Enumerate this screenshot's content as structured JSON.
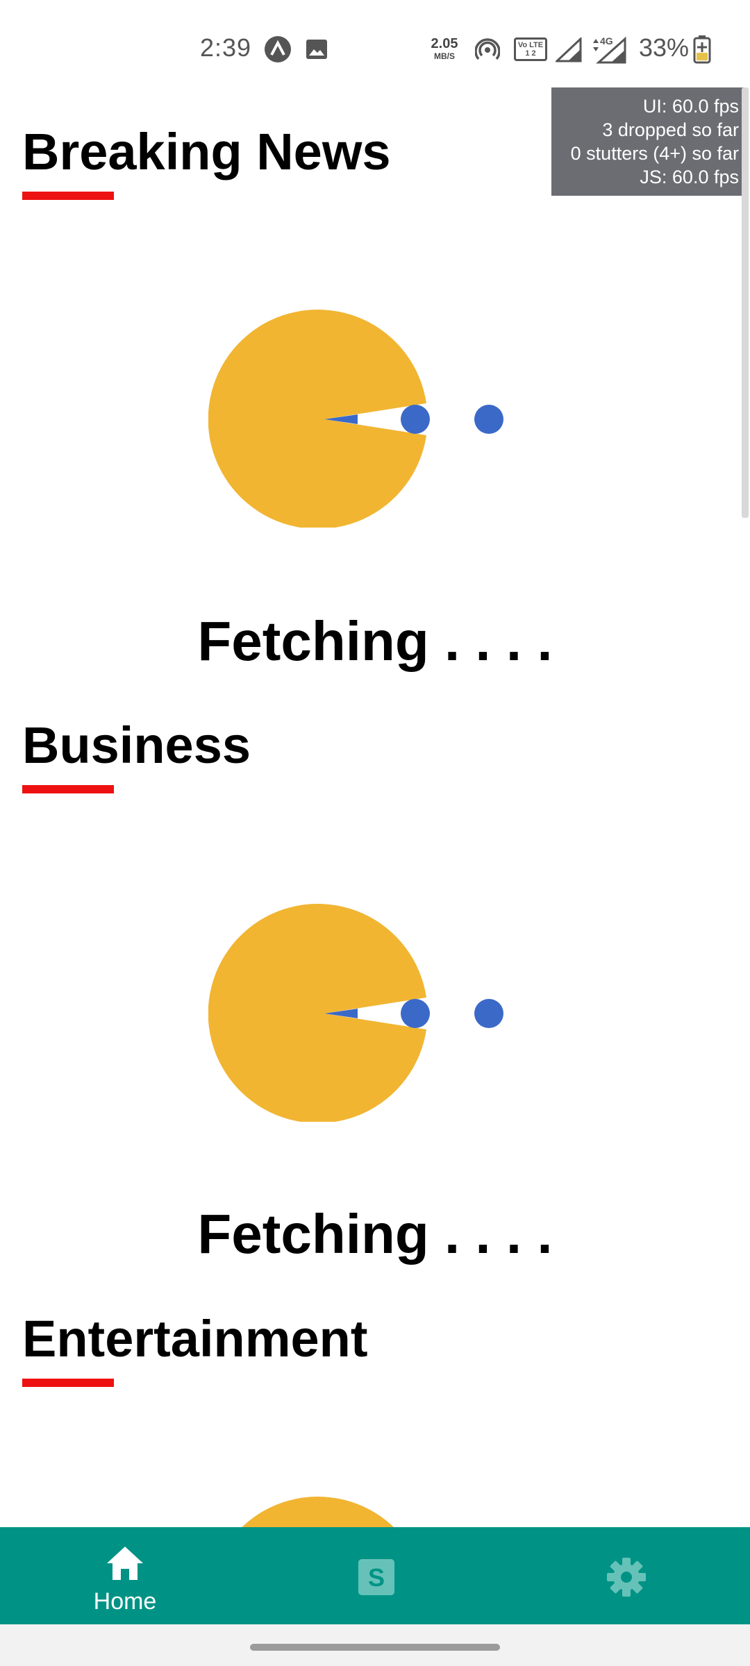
{
  "status_bar": {
    "time": "2:39",
    "icons": [
      "app-a-icon",
      "image-icon",
      "hotspot-icon",
      "signal-icon",
      "signal-4g-icon",
      "battery-icon"
    ],
    "net_speed_value": "2.05",
    "net_speed_unit": "MB/S",
    "volte_label": "Vo LTE 1 2",
    "network_type": "4G",
    "battery_percent": "33%"
  },
  "perf_monitor": {
    "ui_fps": "UI: 60.0 fps",
    "dropped": "3 dropped so far",
    "stutters": "0 stutters (4+) so far",
    "js_fps": "JS: 60.0 fps"
  },
  "sections": [
    {
      "title": "Breaking News",
      "loading_text": "Fetching . . . ."
    },
    {
      "title": "Business",
      "loading_text": "Fetching . . . ."
    },
    {
      "title": "Entertainment",
      "loading_text": ""
    }
  ],
  "colors": {
    "accent_underline": "#ee1111",
    "loader_body": "#f1b532",
    "loader_dots": "#3b69c8",
    "bottom_nav": "#009385"
  },
  "bottom_nav": {
    "items": [
      {
        "label": "Home",
        "icon": "home-icon"
      },
      {
        "label": "",
        "icon": "s-square-icon"
      },
      {
        "label": "",
        "icon": "gear-icon"
      }
    ]
  }
}
